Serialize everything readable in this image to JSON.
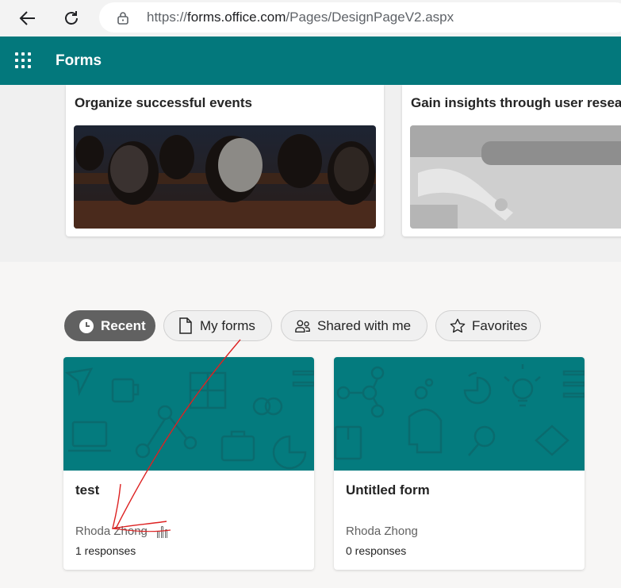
{
  "browser": {
    "url_prefix": "https://",
    "url_host": "forms.office.com",
    "url_path": "/Pages/DesignPageV2.aspx",
    "icons": [
      "back-arrow-icon",
      "reload-icon",
      "lock-icon"
    ]
  },
  "header": {
    "app_title": "Forms",
    "color": "#03787c"
  },
  "templates": [
    {
      "title": "Organize successful events"
    },
    {
      "title": "Gain insights through user research"
    }
  ],
  "tabs": [
    {
      "label": "Recent",
      "icon": "clock-icon",
      "selected": true
    },
    {
      "label": "My forms",
      "icon": "document-icon",
      "selected": false
    },
    {
      "label": "Shared with me",
      "icon": "people-icon",
      "selected": false
    },
    {
      "label": "Favorites",
      "icon": "star-icon",
      "selected": false
    }
  ],
  "forms": [
    {
      "title": "test",
      "owner": "Rhoda Zhong",
      "responses": "1 responses",
      "has_chart_icon": true
    },
    {
      "title": "Untitled form",
      "owner": "Rhoda Zhong",
      "responses": "0 responses",
      "has_chart_icon": false
    }
  ]
}
